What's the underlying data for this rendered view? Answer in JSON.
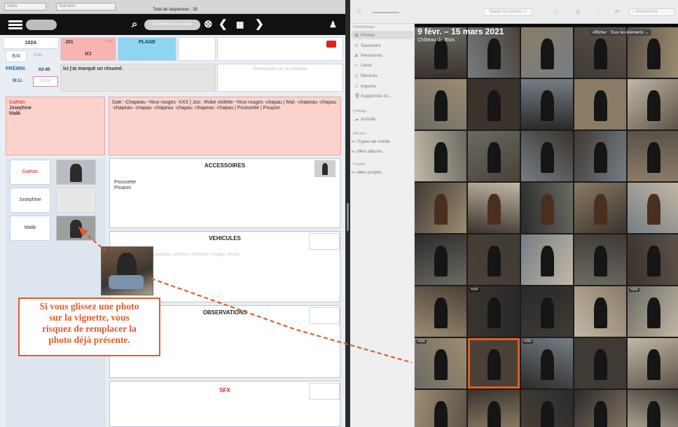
{
  "left_app": {
    "toolstrip": {
      "field1": "Index",
      "field2": "Scénario",
      "total_label": "Total de séquences : 28"
    },
    "header": {
      "search_placeholder": "Chercher un numéro"
    },
    "seq": {
      "number": "102A",
      "code": "J01",
      "lieu_label": "ICI",
      "plage": "PLAGE",
      "ea": "E/A",
      "date": "Date",
      "premin_label": "PRÉMIN.",
      "premin_value": "02:45",
      "mu_label": "M.U.",
      "mu_value": "00:00",
      "resume": "Ici j'ai marqué un résumé.",
      "remarques_placeholder": "Remarques sur le scénario",
      "nuit": "Nuit"
    },
    "cast_names": [
      "Gaëtan",
      "Josephine",
      "Malik"
    ],
    "costumes_text": "Gaë: -Chapeau -Yeux rouges -XXX | Jos: -Robe violette -Yeux rouges -chapau | Mal: -chapeau -chapau -chapeau -chapau -chapeau -chapau -chapeau -chapau | Poussette | Poupon",
    "characters": [
      "Gaëtan",
      "Josephine",
      "Malik"
    ],
    "sections": {
      "accessoires": {
        "title": "ACCESSOIRES",
        "lines": [
          "Poussette",
          "Poupon"
        ]
      },
      "vehicules": {
        "title": "VEHICULES",
        "placeholder": "Cascades, animaux, véhicules, images, décors"
      },
      "observations": {
        "title": "OBSERVATIONS"
      },
      "sfx": {
        "title": "SFX"
      }
    },
    "callout_lines": [
      "Si vous glissez une photo",
      "sur la vignette, vous",
      "risquez de remplacer la",
      "photo déjà présente."
    ],
    "colors": {
      "accent_red": "#e25c2b",
      "pink": "#f7b5b1",
      "cyan": "#8fd5f2"
    }
  },
  "photos_app": {
    "toolbar": {
      "filter": "Toutes les photos ◇",
      "search": "Rechercher"
    },
    "sidebar": {
      "library_header": "Photothèque",
      "library_items": [
        {
          "icon": "photos-icon",
          "label": "Photos"
        },
        {
          "icon": "memories-icon",
          "label": "Souvenirs"
        },
        {
          "icon": "people-icon",
          "label": "Personnes"
        },
        {
          "icon": "places-icon",
          "label": "Lieux"
        },
        {
          "icon": "recents-icon",
          "label": "Récents"
        },
        {
          "icon": "imports-icon",
          "label": "Imports"
        },
        {
          "icon": "trash-icon",
          "label": "Supprimés ré..."
        }
      ],
      "sharing_header": "Partagé",
      "sharing_items": [
        {
          "icon": "activity-icon",
          "label": "Activité"
        }
      ],
      "albums_header": "Albums",
      "albums_items": [
        {
          "icon": "folder-icon",
          "label": "Types de média"
        },
        {
          "icon": "folder-icon",
          "label": "Mes albums"
        }
      ],
      "projects_header": "Projets",
      "projects_items": [
        {
          "icon": "folder-icon",
          "label": "Mes projets"
        }
      ]
    },
    "grid": {
      "date_range": "9 févr. – 15 mars 2021",
      "location": "Château de Blois",
      "show_button": "Afficher : Tous les éléments ⌄",
      "hdr_badge": "HDR"
    }
  }
}
